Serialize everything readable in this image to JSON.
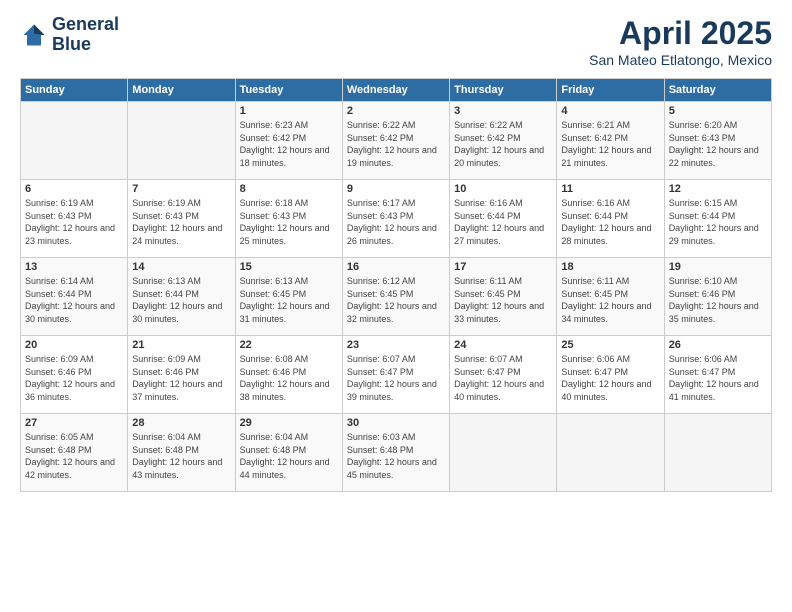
{
  "logo": {
    "line1": "General",
    "line2": "Blue"
  },
  "title": "April 2025",
  "subtitle": "San Mateo Etlatongo, Mexico",
  "days_of_week": [
    "Sunday",
    "Monday",
    "Tuesday",
    "Wednesday",
    "Thursday",
    "Friday",
    "Saturday"
  ],
  "weeks": [
    [
      {
        "day": "",
        "sunrise": "",
        "sunset": "",
        "daylight": ""
      },
      {
        "day": "",
        "sunrise": "",
        "sunset": "",
        "daylight": ""
      },
      {
        "day": "1",
        "sunrise": "Sunrise: 6:23 AM",
        "sunset": "Sunset: 6:42 PM",
        "daylight": "Daylight: 12 hours and 18 minutes."
      },
      {
        "day": "2",
        "sunrise": "Sunrise: 6:22 AM",
        "sunset": "Sunset: 6:42 PM",
        "daylight": "Daylight: 12 hours and 19 minutes."
      },
      {
        "day": "3",
        "sunrise": "Sunrise: 6:22 AM",
        "sunset": "Sunset: 6:42 PM",
        "daylight": "Daylight: 12 hours and 20 minutes."
      },
      {
        "day": "4",
        "sunrise": "Sunrise: 6:21 AM",
        "sunset": "Sunset: 6:42 PM",
        "daylight": "Daylight: 12 hours and 21 minutes."
      },
      {
        "day": "5",
        "sunrise": "Sunrise: 6:20 AM",
        "sunset": "Sunset: 6:43 PM",
        "daylight": "Daylight: 12 hours and 22 minutes."
      }
    ],
    [
      {
        "day": "6",
        "sunrise": "Sunrise: 6:19 AM",
        "sunset": "Sunset: 6:43 PM",
        "daylight": "Daylight: 12 hours and 23 minutes."
      },
      {
        "day": "7",
        "sunrise": "Sunrise: 6:19 AM",
        "sunset": "Sunset: 6:43 PM",
        "daylight": "Daylight: 12 hours and 24 minutes."
      },
      {
        "day": "8",
        "sunrise": "Sunrise: 6:18 AM",
        "sunset": "Sunset: 6:43 PM",
        "daylight": "Daylight: 12 hours and 25 minutes."
      },
      {
        "day": "9",
        "sunrise": "Sunrise: 6:17 AM",
        "sunset": "Sunset: 6:43 PM",
        "daylight": "Daylight: 12 hours and 26 minutes."
      },
      {
        "day": "10",
        "sunrise": "Sunrise: 6:16 AM",
        "sunset": "Sunset: 6:44 PM",
        "daylight": "Daylight: 12 hours and 27 minutes."
      },
      {
        "day": "11",
        "sunrise": "Sunrise: 6:16 AM",
        "sunset": "Sunset: 6:44 PM",
        "daylight": "Daylight: 12 hours and 28 minutes."
      },
      {
        "day": "12",
        "sunrise": "Sunrise: 6:15 AM",
        "sunset": "Sunset: 6:44 PM",
        "daylight": "Daylight: 12 hours and 29 minutes."
      }
    ],
    [
      {
        "day": "13",
        "sunrise": "Sunrise: 6:14 AM",
        "sunset": "Sunset: 6:44 PM",
        "daylight": "Daylight: 12 hours and 30 minutes."
      },
      {
        "day": "14",
        "sunrise": "Sunrise: 6:13 AM",
        "sunset": "Sunset: 6:44 PM",
        "daylight": "Daylight: 12 hours and 30 minutes."
      },
      {
        "day": "15",
        "sunrise": "Sunrise: 6:13 AM",
        "sunset": "Sunset: 6:45 PM",
        "daylight": "Daylight: 12 hours and 31 minutes."
      },
      {
        "day": "16",
        "sunrise": "Sunrise: 6:12 AM",
        "sunset": "Sunset: 6:45 PM",
        "daylight": "Daylight: 12 hours and 32 minutes."
      },
      {
        "day": "17",
        "sunrise": "Sunrise: 6:11 AM",
        "sunset": "Sunset: 6:45 PM",
        "daylight": "Daylight: 12 hours and 33 minutes."
      },
      {
        "day": "18",
        "sunrise": "Sunrise: 6:11 AM",
        "sunset": "Sunset: 6:45 PM",
        "daylight": "Daylight: 12 hours and 34 minutes."
      },
      {
        "day": "19",
        "sunrise": "Sunrise: 6:10 AM",
        "sunset": "Sunset: 6:46 PM",
        "daylight": "Daylight: 12 hours and 35 minutes."
      }
    ],
    [
      {
        "day": "20",
        "sunrise": "Sunrise: 6:09 AM",
        "sunset": "Sunset: 6:46 PM",
        "daylight": "Daylight: 12 hours and 36 minutes."
      },
      {
        "day": "21",
        "sunrise": "Sunrise: 6:09 AM",
        "sunset": "Sunset: 6:46 PM",
        "daylight": "Daylight: 12 hours and 37 minutes."
      },
      {
        "day": "22",
        "sunrise": "Sunrise: 6:08 AM",
        "sunset": "Sunset: 6:46 PM",
        "daylight": "Daylight: 12 hours and 38 minutes."
      },
      {
        "day": "23",
        "sunrise": "Sunrise: 6:07 AM",
        "sunset": "Sunset: 6:47 PM",
        "daylight": "Daylight: 12 hours and 39 minutes."
      },
      {
        "day": "24",
        "sunrise": "Sunrise: 6:07 AM",
        "sunset": "Sunset: 6:47 PM",
        "daylight": "Daylight: 12 hours and 40 minutes."
      },
      {
        "day": "25",
        "sunrise": "Sunrise: 6:06 AM",
        "sunset": "Sunset: 6:47 PM",
        "daylight": "Daylight: 12 hours and 40 minutes."
      },
      {
        "day": "26",
        "sunrise": "Sunrise: 6:06 AM",
        "sunset": "Sunset: 6:47 PM",
        "daylight": "Daylight: 12 hours and 41 minutes."
      }
    ],
    [
      {
        "day": "27",
        "sunrise": "Sunrise: 6:05 AM",
        "sunset": "Sunset: 6:48 PM",
        "daylight": "Daylight: 12 hours and 42 minutes."
      },
      {
        "day": "28",
        "sunrise": "Sunrise: 6:04 AM",
        "sunset": "Sunset: 6:48 PM",
        "daylight": "Daylight: 12 hours and 43 minutes."
      },
      {
        "day": "29",
        "sunrise": "Sunrise: 6:04 AM",
        "sunset": "Sunset: 6:48 PM",
        "daylight": "Daylight: 12 hours and 44 minutes."
      },
      {
        "day": "30",
        "sunrise": "Sunrise: 6:03 AM",
        "sunset": "Sunset: 6:48 PM",
        "daylight": "Daylight: 12 hours and 45 minutes."
      },
      {
        "day": "",
        "sunrise": "",
        "sunset": "",
        "daylight": ""
      },
      {
        "day": "",
        "sunrise": "",
        "sunset": "",
        "daylight": ""
      },
      {
        "day": "",
        "sunrise": "",
        "sunset": "",
        "daylight": ""
      }
    ]
  ]
}
